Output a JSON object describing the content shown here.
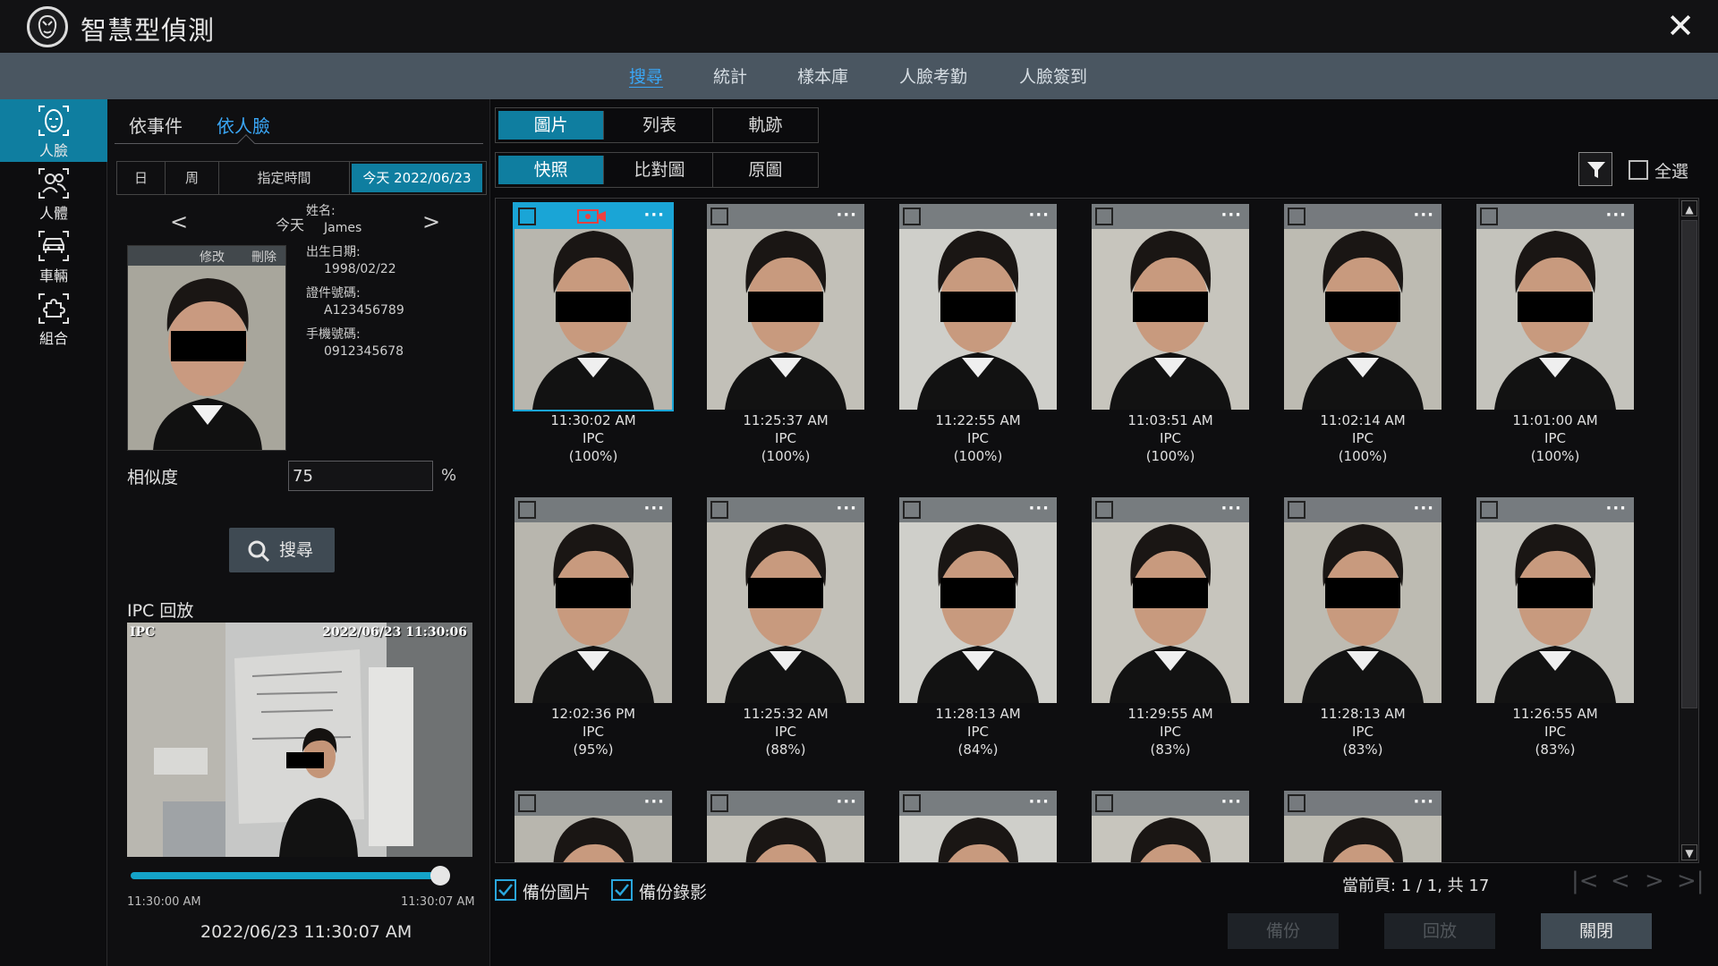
{
  "app": {
    "title": "智慧型偵測"
  },
  "topnav": {
    "tabs": [
      "搜尋",
      "統計",
      "樣本庫",
      "人臉考勤",
      "人臉簽到"
    ]
  },
  "rail": {
    "items": [
      {
        "label": "人臉",
        "icon": "face-icon"
      },
      {
        "label": "人體",
        "icon": "body-icon"
      },
      {
        "label": "車輛",
        "icon": "vehicle-icon"
      },
      {
        "label": "組合",
        "icon": "combine-icon"
      }
    ]
  },
  "left": {
    "subtabs": [
      "依事件",
      "依人臉"
    ],
    "date_segments": [
      "日",
      "周",
      "指定時間",
      "今天 2022/06/23"
    ],
    "day_label": "今天",
    "photo_controls": {
      "edit": "修改",
      "delete": "刪除"
    },
    "info": {
      "name_label": "姓名:",
      "name": "James",
      "dob_label": "出生日期:",
      "dob": "1998/02/22",
      "id_label": "證件號碼:",
      "id": "A123456789",
      "phone_label": "手機號碼:",
      "phone": "0912345678"
    },
    "similarity_label": "相似度",
    "similarity_value": "75",
    "similarity_unit": "%",
    "search_button": "搜尋",
    "ipc_title": "IPC 回放",
    "video_overlay_left": "IPC",
    "video_overlay_right": "2022/06/23 11:30:06",
    "timeline_start": "11:30:00 AM",
    "timeline_end": "11:30:07 AM",
    "timeline_progress": 1.0,
    "current_time": "2022/06/23 11:30:07 AM"
  },
  "right": {
    "view_tabs": [
      "圖片",
      "列表",
      "軌跡"
    ],
    "image_tabs": [
      "快照",
      "比對圖",
      "原圖"
    ],
    "select_all": "全選",
    "results": [
      {
        "time": "11:30:02 AM",
        "source": "IPC",
        "score": "(100%)"
      },
      {
        "time": "11:25:37 AM",
        "source": "IPC",
        "score": "(100%)"
      },
      {
        "time": "11:22:55 AM",
        "source": "IPC",
        "score": "(100%)"
      },
      {
        "time": "11:03:51 AM",
        "source": "IPC",
        "score": "(100%)"
      },
      {
        "time": "11:02:14 AM",
        "source": "IPC",
        "score": "(100%)"
      },
      {
        "time": "11:01:00 AM",
        "source": "IPC",
        "score": "(100%)"
      },
      {
        "time": "12:02:36 PM",
        "source": "IPC",
        "score": "(95%)"
      },
      {
        "time": "11:25:32 AM",
        "source": "IPC",
        "score": "(88%)"
      },
      {
        "time": "11:28:13 AM",
        "source": "IPC",
        "score": "(84%)"
      },
      {
        "time": "11:29:55 AM",
        "source": "IPC",
        "score": "(83%)"
      },
      {
        "time": "11:28:13 AM",
        "source": "IPC",
        "score": "(83%)"
      },
      {
        "time": "11:26:55 AM",
        "source": "IPC",
        "score": "(83%)"
      }
    ],
    "partial_cards": 5,
    "backup_image": "備份圖片",
    "backup_video": "備份錄影",
    "page_info": "當前頁: 1 / 1, 共 17",
    "buttons": {
      "backup": "備份",
      "playback": "回放",
      "close": "關閉"
    }
  },
  "colors": {
    "accent": "#0f7ea0",
    "active_text": "#3aa6f5",
    "nav_bar": "#4a5661"
  }
}
